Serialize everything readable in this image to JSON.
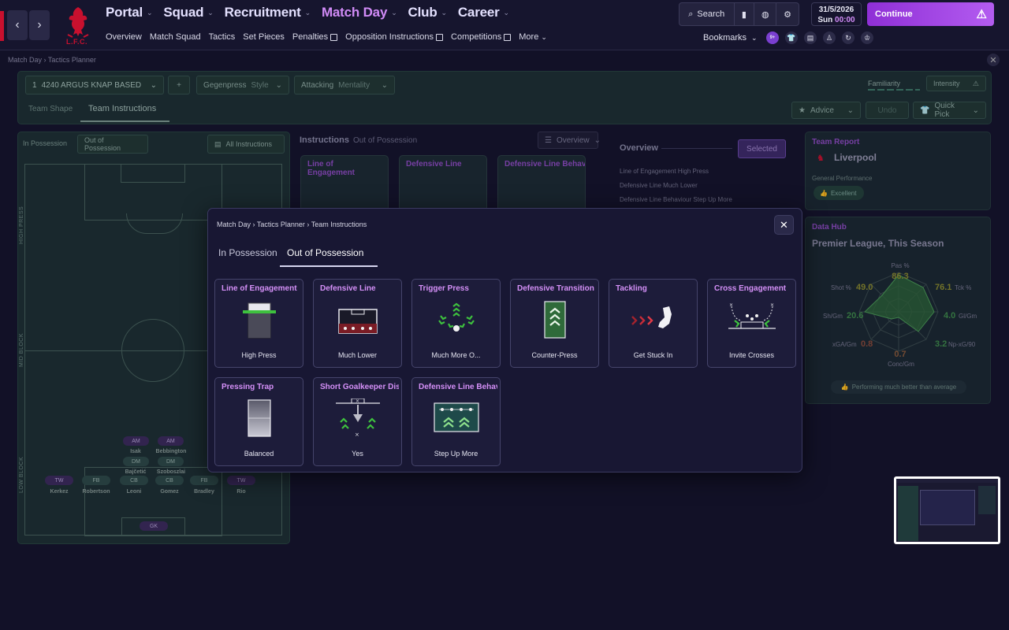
{
  "club": {
    "crest_text": "L.F.C."
  },
  "nav": {
    "main": [
      {
        "label": "Portal",
        "active": false
      },
      {
        "label": "Squad",
        "active": false
      },
      {
        "label": "Recruitment",
        "active": false
      },
      {
        "label": "Match Day",
        "active": true
      },
      {
        "label": "Club",
        "active": false
      },
      {
        "label": "Career",
        "active": false
      }
    ],
    "sub": [
      {
        "label": "Overview",
        "external": false
      },
      {
        "label": "Match Squad",
        "external": false
      },
      {
        "label": "Tactics",
        "external": false
      },
      {
        "label": "Set Pieces",
        "external": false
      },
      {
        "label": "Penalties",
        "external": true
      },
      {
        "label": "Opposition Instructions",
        "external": true
      },
      {
        "label": "Competitions",
        "external": true
      },
      {
        "label": "More",
        "external": false
      }
    ]
  },
  "toolbar": {
    "search_label": "Search",
    "date": "31/5/2026",
    "day": "Sun",
    "time": "00:00",
    "continue_label": "Continue",
    "bookmarks_label": "Bookmarks",
    "notif_badge": "9+"
  },
  "breadcrumb": {
    "root": "Match Day",
    "current": "Tactics Planner"
  },
  "tactic": {
    "slot": "1",
    "name": "4240 ARGUS KNAP BASED",
    "style_value": "Gegenpress",
    "style_label": "Style",
    "mentality_value": "Attacking",
    "mentality_label": "Mentality",
    "familiarity_label": "Familiarity",
    "intensity_label": "Intensity",
    "tabs": [
      "Team Shape",
      "Team Instructions"
    ],
    "advice_label": "Advice",
    "undo_label": "Undo",
    "quickpick_label": "Quick Pick"
  },
  "pitch_panel": {
    "tabs": [
      "In Possession",
      "Out of Possession"
    ],
    "all_instructions_label": "All Instructions",
    "zones": [
      "HIGH PRESS",
      "MID BLOCK",
      "LOW BLOCK"
    ],
    "players": [
      {
        "pos": "AM",
        "name": "Isak",
        "color": "purple"
      },
      {
        "pos": "AM",
        "name": "Bebbington",
        "color": "purple"
      },
      {
        "pos": "DM",
        "name": "Bajčetić",
        "color": "green"
      },
      {
        "pos": "DM",
        "name": "Szoboszlai",
        "color": "green"
      },
      {
        "pos": "TW",
        "name": "Kerkez",
        "color": "purple"
      },
      {
        "pos": "FB",
        "name": "Robertson",
        "color": "green"
      },
      {
        "pos": "CB",
        "name": "Leoni",
        "color": "green"
      },
      {
        "pos": "CB",
        "name": "Gomez",
        "color": "green"
      },
      {
        "pos": "FB",
        "name": "Bradley",
        "color": "green"
      },
      {
        "pos": "TW",
        "name": "Rio",
        "color": "purple"
      },
      {
        "pos": "GK",
        "name": "",
        "color": "purple"
      }
    ]
  },
  "instructions_panel": {
    "title": "Instructions",
    "subtitle": "Out of Possession",
    "view_label": "Overview",
    "cards": [
      "Line of Engagement",
      "Defensive Line",
      "Defensive Line Behavic"
    ]
  },
  "overview_panel": {
    "title": "Overview",
    "selected_label": "Selected",
    "rows": [
      {
        "k": "Line of Engagement",
        "v": "High Press"
      },
      {
        "k": "Defensive Line",
        "v": "Much Lower"
      },
      {
        "k": "Defensive Line Behaviour",
        "v": "Step Up More"
      }
    ]
  },
  "team_report": {
    "title": "Team Report",
    "team": "Liverpool",
    "perf_label": "General Performance",
    "perf_value": "Excellent"
  },
  "data_hub": {
    "title": "Data Hub",
    "subtitle": "Premier League, This Season",
    "metrics": [
      {
        "label": "Pas %",
        "value": "86.3"
      },
      {
        "label": "Tck %",
        "value": "76.1"
      },
      {
        "label": "Gl/Gm",
        "value": "4.0"
      },
      {
        "label": "Np-xG/90",
        "value": "3.2"
      },
      {
        "label": "Conc/Gm",
        "value": "0.7"
      },
      {
        "label": "xGA/Gm",
        "value": "0.8"
      },
      {
        "label": "Sh/Gm",
        "value": "20.6"
      },
      {
        "label": "Shot %",
        "value": "49.0"
      }
    ],
    "footer": "Performing much better than average"
  },
  "modal": {
    "crumbs": [
      "Match Day",
      "Tactics Planner",
      "Team Instructions"
    ],
    "tabs": [
      "In Possession",
      "Out of Possession"
    ],
    "cards": [
      {
        "title": "Line of Engagement",
        "value": "High Press",
        "icon": "line-of-engagement-icon"
      },
      {
        "title": "Defensive Line",
        "value": "Much Lower",
        "icon": "defensive-line-icon"
      },
      {
        "title": "Trigger Press",
        "value": "Much More O...",
        "icon": "trigger-press-icon"
      },
      {
        "title": "Defensive Transition",
        "value": "Counter-Press",
        "icon": "defensive-transition-icon"
      },
      {
        "title": "Tackling",
        "value": "Get Stuck In",
        "icon": "tackling-boot-icon"
      },
      {
        "title": "Cross Engagement",
        "value": "Invite Crosses",
        "icon": "cross-engagement-icon"
      },
      {
        "title": "Pressing Trap",
        "value": "Balanced",
        "icon": "pressing-trap-icon"
      },
      {
        "title": "Short Goalkeeper Distr",
        "value": "Yes",
        "icon": "goalkeeper-distribution-icon"
      },
      {
        "title": "Defensive Line Behavic",
        "value": "Step Up More",
        "icon": "defensive-line-behaviour-icon"
      }
    ]
  },
  "colors": {
    "accent_purple": "#d18bf7",
    "continue_gradient": "#8f2fd6",
    "press_green": "#3ec13e",
    "red_dots": "#c8313d"
  }
}
